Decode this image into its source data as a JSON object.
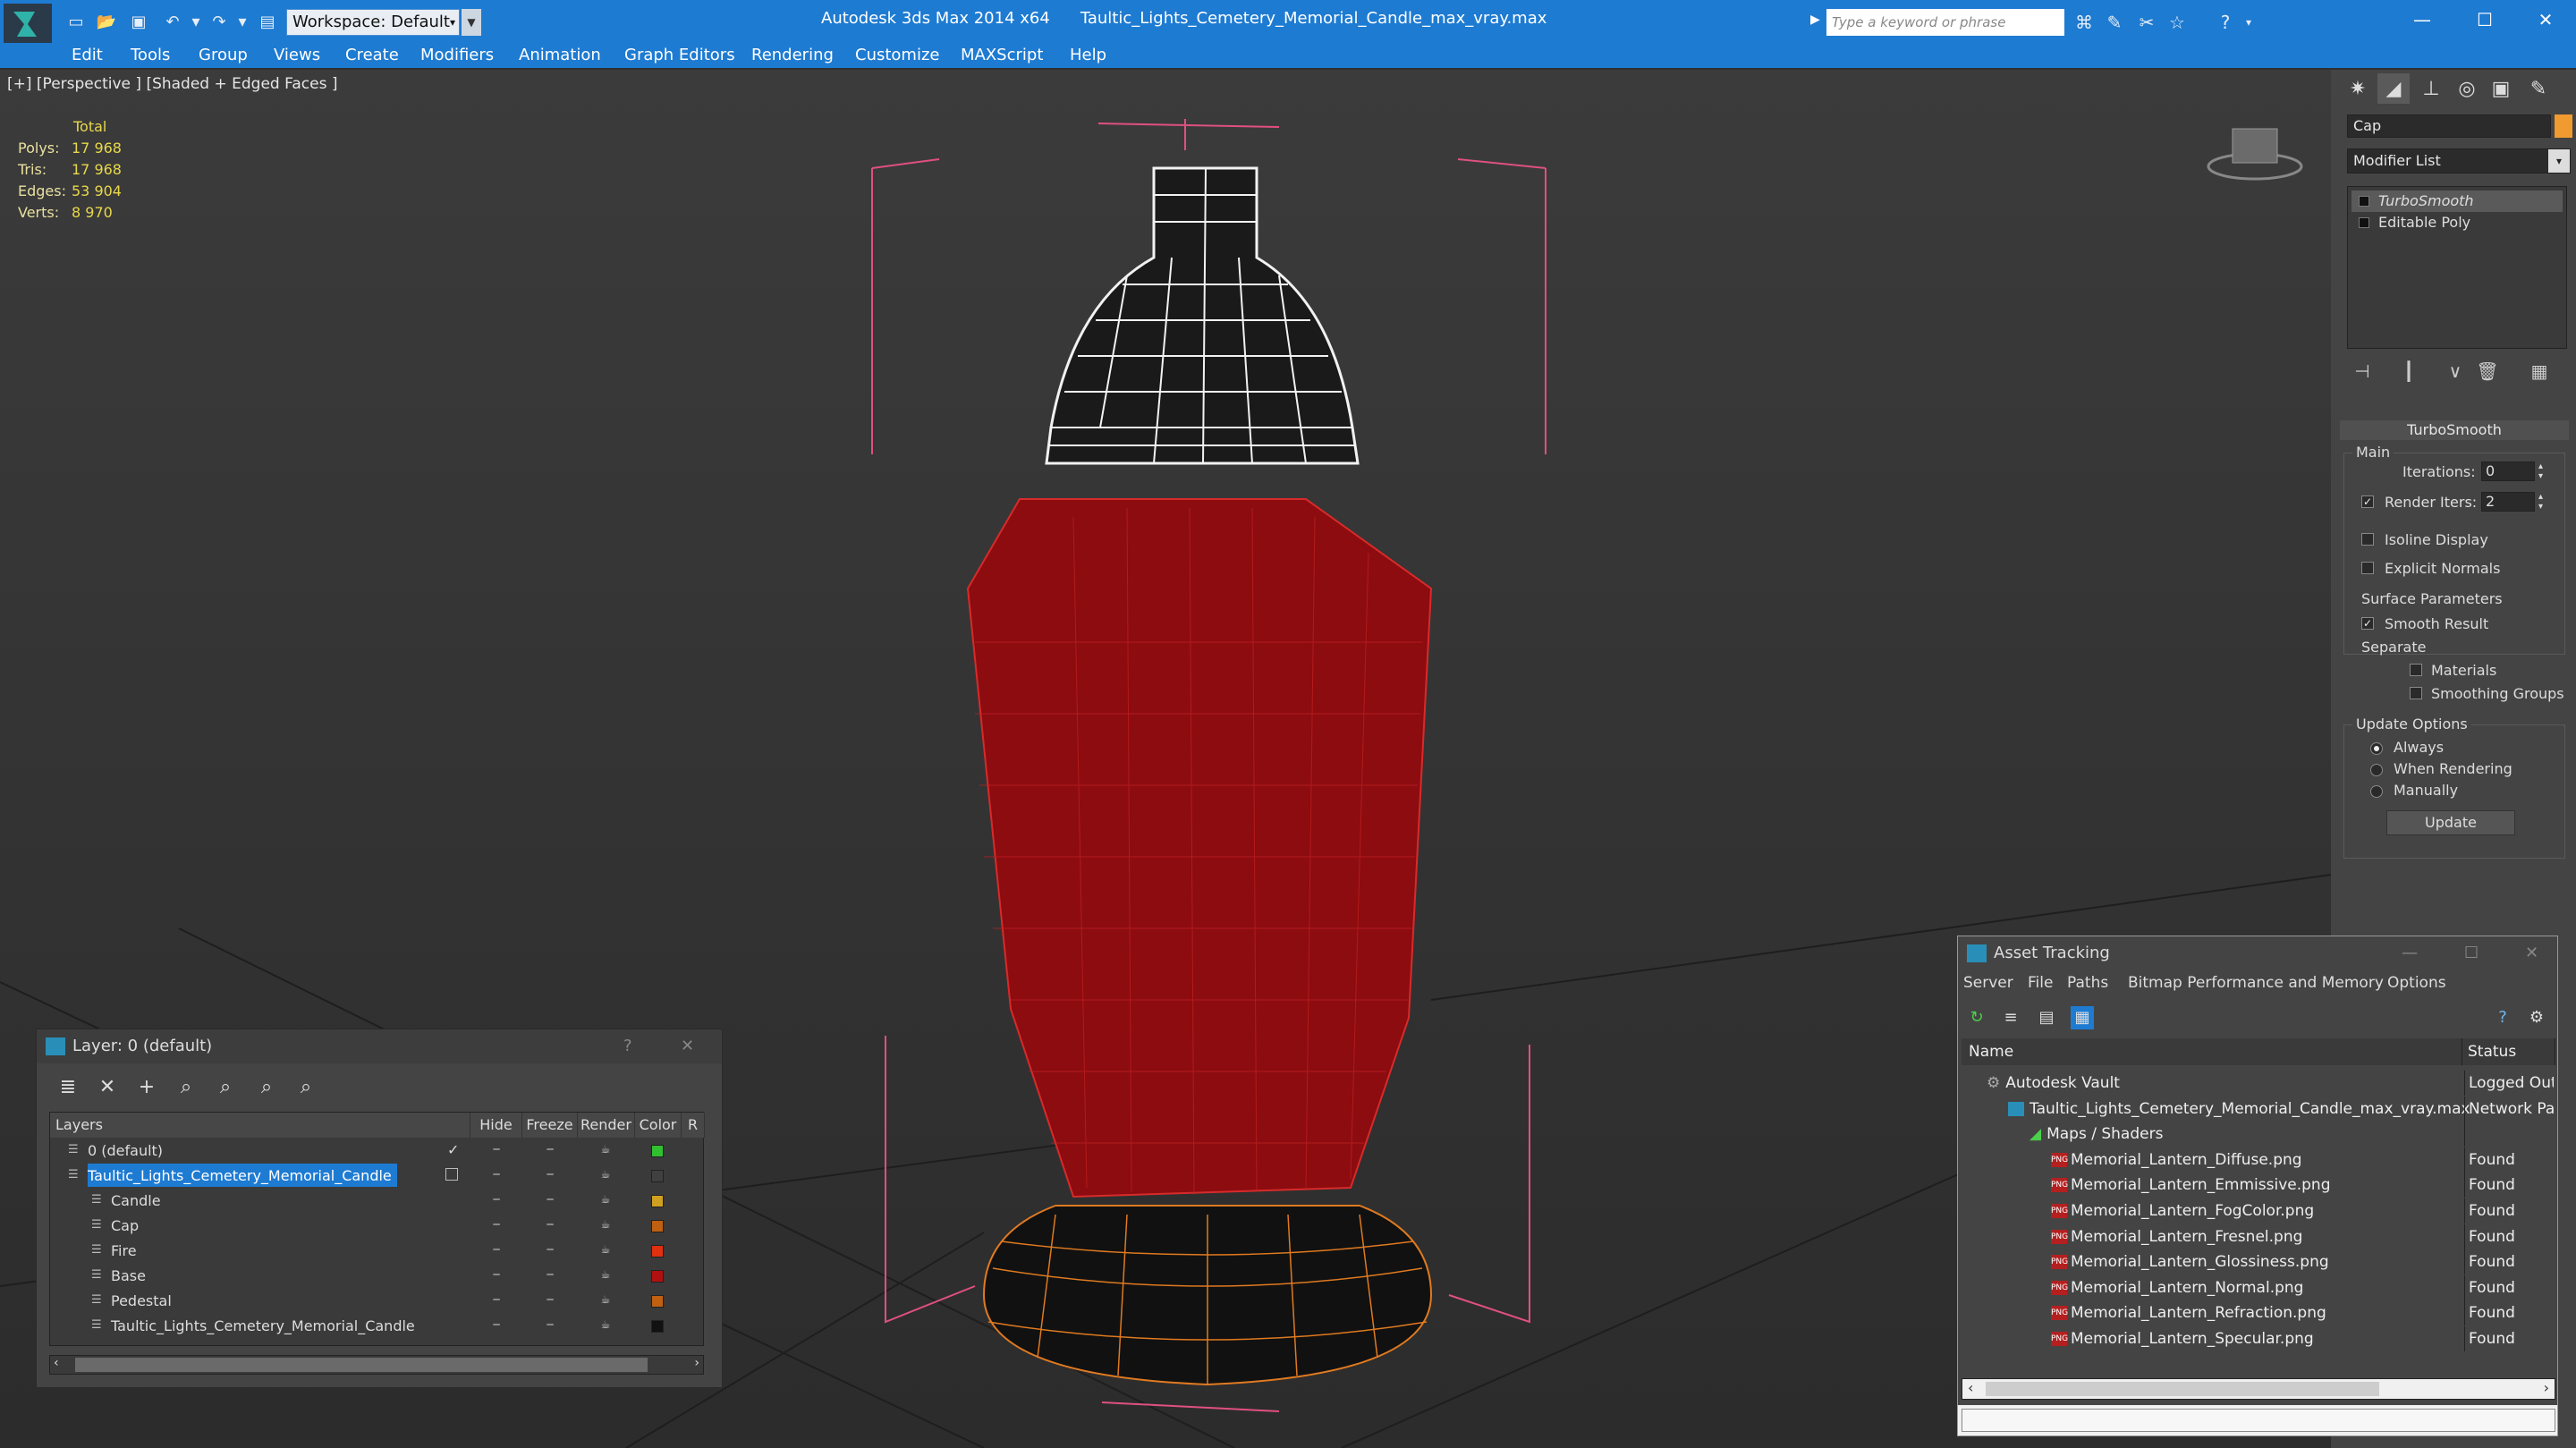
{
  "titlebar": {
    "workspace": "Workspace: Default",
    "app_name": "Autodesk 3ds Max  2014 x64",
    "file_name": "Taultic_Lights_Cemetery_Memorial_Candle_max_vray.max",
    "search_placeholder": "Type a keyword or phrase"
  },
  "menu": [
    "Edit",
    "Tools",
    "Group",
    "Views",
    "Create",
    "Modifiers",
    "Animation",
    "Graph Editors",
    "Rendering",
    "Customize",
    "MAXScript",
    "Help"
  ],
  "viewport": {
    "label": "[+] [Perspective ] [Shaded + Edged Faces ]",
    "stats": {
      "header": "Total",
      "rows": [
        {
          "k": "Polys:",
          "v": "17 968"
        },
        {
          "k": "Tris:",
          "v": "17 968"
        },
        {
          "k": "Edges:",
          "v": "53 904"
        },
        {
          "k": "Verts:",
          "v": "8 970"
        }
      ]
    },
    "candle_color": "#8c0c10",
    "base_color": "#111111"
  },
  "command_panel": {
    "object_name": "Cap",
    "object_color": "#f09a30",
    "modifier_list": "Modifier List",
    "stack": [
      "TurboSmooth",
      "Editable Poly"
    ],
    "rollout_title": "TurboSmooth",
    "main_label": "Main",
    "iterations_label": "Iterations:",
    "iterations_value": "0",
    "render_iters_label": "Render Iters:",
    "render_iters_value": "2",
    "isoline": "Isoline Display",
    "explicit": "Explicit Normals",
    "surface_params": "Surface Parameters",
    "smooth_result": "Smooth Result",
    "separate": "Separate",
    "materials": "Materials",
    "smoothing_groups": "Smoothing Groups",
    "update_options": "Update Options",
    "always": "Always",
    "when_rendering": "When Rendering",
    "manually": "Manually",
    "update_btn": "Update"
  },
  "layer_dialog": {
    "title": "Layer: 0 (default)",
    "help": "?",
    "columns": [
      "Layers",
      "Hide",
      "Freeze",
      "Render",
      "Color",
      "R"
    ],
    "rows": [
      {
        "name": "0 (default)",
        "color": "#30c030",
        "indent": 0,
        "selected": false
      },
      {
        "name": "Taultic_Lights_Cemetery_Memorial_Candle",
        "color": "#404040",
        "indent": 0,
        "selected": true
      },
      {
        "name": "Candle",
        "color": "#d0a020",
        "indent": 1,
        "selected": false
      },
      {
        "name": "Cap",
        "color": "#c06010",
        "indent": 1,
        "selected": false
      },
      {
        "name": "Fire",
        "color": "#e03010",
        "indent": 1,
        "selected": false
      },
      {
        "name": "Base",
        "color": "#b01010",
        "indent": 1,
        "selected": false
      },
      {
        "name": "Pedestal",
        "color": "#c06010",
        "indent": 1,
        "selected": false
      },
      {
        "name": "Taultic_Lights_Cemetery_Memorial_Candle",
        "color": "#111111",
        "indent": 1,
        "selected": false
      }
    ]
  },
  "asset_tracking": {
    "title": "Asset Tracking",
    "menu": [
      "Server",
      "File",
      "Paths",
      "Bitmap Performance and Memory",
      "Options"
    ],
    "columns": [
      "Name",
      "Status"
    ],
    "rows": [
      {
        "name": "Autodesk Vault",
        "status": "Logged Out",
        "level": 0
      },
      {
        "name": "Taultic_Lights_Cemetery_Memorial_Candle_max_vray.max",
        "status": "Network Pa",
        "level": 1
      },
      {
        "name": "Maps / Shaders",
        "status": "",
        "level": 2
      },
      {
        "name": "Memorial_Lantern_Diffuse.png",
        "status": "Found",
        "level": 3
      },
      {
        "name": "Memorial_Lantern_Emmissive.png",
        "status": "Found",
        "level": 3
      },
      {
        "name": "Memorial_Lantern_FogColor.png",
        "status": "Found",
        "level": 3
      },
      {
        "name": "Memorial_Lantern_Fresnel.png",
        "status": "Found",
        "level": 3
      },
      {
        "name": "Memorial_Lantern_Glossiness.png",
        "status": "Found",
        "level": 3
      },
      {
        "name": "Memorial_Lantern_Normal.png",
        "status": "Found",
        "level": 3
      },
      {
        "name": "Memorial_Lantern_Refraction.png",
        "status": "Found",
        "level": 3
      },
      {
        "name": "Memorial_Lantern_Specular.png",
        "status": "Found",
        "level": 3
      }
    ]
  }
}
